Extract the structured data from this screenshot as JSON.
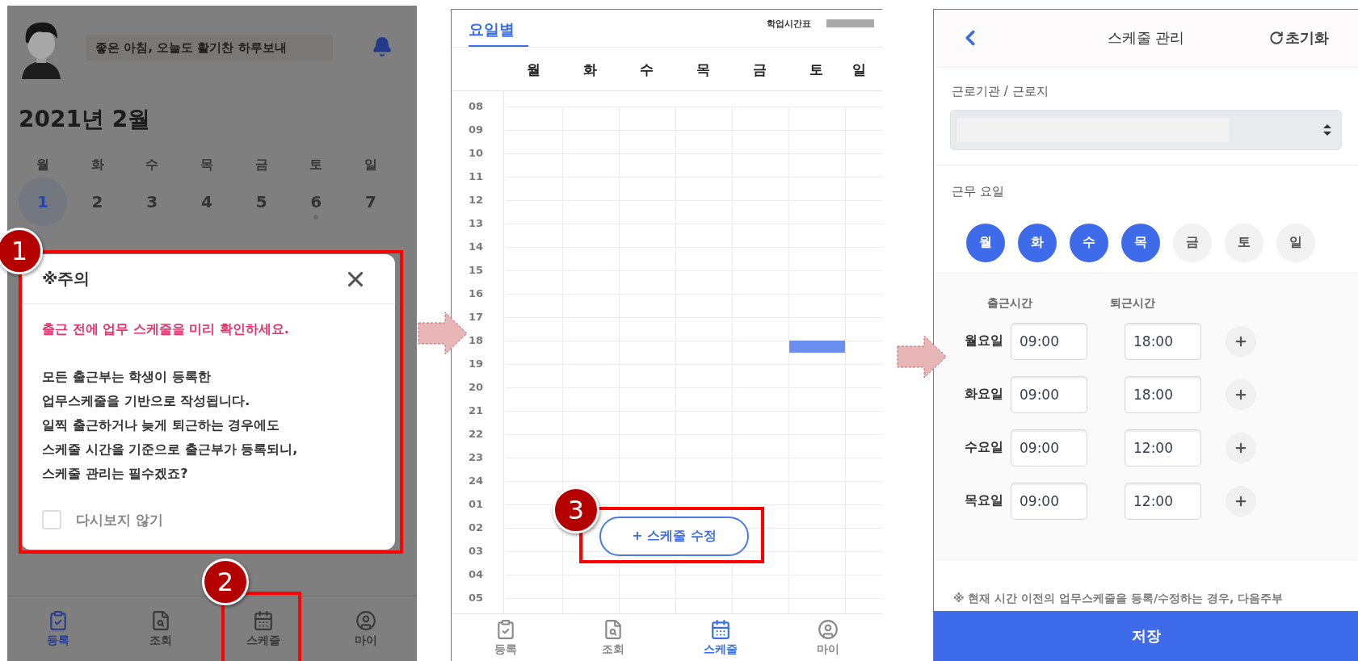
{
  "home_screen": {
    "greeting": "좋은 아침, 오늘도 활기찬 하루보내",
    "month_title": "2021년 2월",
    "weekdays": [
      "월",
      "화",
      "수",
      "목",
      "금",
      "토",
      "일"
    ],
    "dates": [
      {
        "label": "1",
        "selected": true,
        "dot": false
      },
      {
        "label": "2",
        "selected": false,
        "dot": false
      },
      {
        "label": "3",
        "selected": false,
        "dot": false
      },
      {
        "label": "4",
        "selected": false,
        "dot": false
      },
      {
        "label": "5",
        "selected": false,
        "dot": false
      },
      {
        "label": "6",
        "selected": false,
        "dot": true
      },
      {
        "label": "7",
        "selected": false,
        "dot": false
      }
    ],
    "dialog": {
      "title": "※주의",
      "notice": "출근 전에 업무 스케줄을 미리 확인하세요.",
      "message_lines": [
        "모든 출근부는 학생이 등록한",
        "업무스케줄을 기반으로 작성됩니다.",
        "일찍 출근하거나 늦게 퇴근하는 경우에도",
        "스케줄 시간을 기준으로 출근부가 등록되니,",
        "스케줄 관리는 필수겠죠?"
      ],
      "checkbox": {
        "label": "다시보지 않기",
        "checked": false
      }
    },
    "nav": [
      {
        "label": "등록",
        "kind": "register",
        "selected": true
      },
      {
        "label": "조회",
        "kind": "search",
        "selected": false
      },
      {
        "label": "스케줄",
        "kind": "schedule",
        "selected": false
      },
      {
        "label": "마이",
        "kind": "profile",
        "selected": false
      }
    ]
  },
  "timetable_screen": {
    "tab": {
      "label": "요일별",
      "selected": true
    },
    "timetable_label": "학업시간표",
    "days": [
      {
        "label": "월"
      },
      {
        "label": "화"
      },
      {
        "label": "수"
      },
      {
        "label": "목"
      },
      {
        "label": "금"
      },
      {
        "label": "토"
      },
      {
        "label": "일"
      }
    ],
    "hours": [
      {
        "label": "08"
      },
      {
        "label": "09"
      },
      {
        "label": "10"
      },
      {
        "label": "11"
      },
      {
        "label": "12"
      },
      {
        "label": "13"
      },
      {
        "label": "14"
      },
      {
        "label": "15"
      },
      {
        "label": "16"
      },
      {
        "label": "17"
      },
      {
        "label": "18",
        "booked": [
          false,
          false,
          false,
          false,
          false,
          true,
          false
        ]
      },
      {
        "label": "19"
      },
      {
        "label": "20"
      },
      {
        "label": "21"
      },
      {
        "label": "22"
      },
      {
        "label": "23"
      },
      {
        "label": "24"
      },
      {
        "label": "01"
      },
      {
        "label": "02"
      },
      {
        "label": "03"
      },
      {
        "label": "04"
      },
      {
        "label": "05"
      }
    ],
    "edit_button": "+ 스케줄 수정",
    "nav": [
      {
        "label": "등록",
        "kind": "register",
        "selected": false
      },
      {
        "label": "조회",
        "kind": "search",
        "selected": false
      },
      {
        "label": "스케줄",
        "kind": "schedule",
        "selected": true
      },
      {
        "label": "마이",
        "kind": "profile",
        "selected": false
      }
    ]
  },
  "schedule_screen": {
    "title": "스케줄 관리",
    "reset": "초기화",
    "workplace_label": "근로기관 / 근로지",
    "workdays_label": "근무 요일",
    "days": [
      {
        "label": "월",
        "selected": true
      },
      {
        "label": "화",
        "selected": true
      },
      {
        "label": "수",
        "selected": true
      },
      {
        "label": "목",
        "selected": true
      },
      {
        "label": "금",
        "selected": false
      },
      {
        "label": "토",
        "selected": false
      },
      {
        "label": "일",
        "selected": false
      }
    ],
    "time_headers": [
      "출근시간",
      "퇴근시간"
    ],
    "rows": [
      {
        "day": "월요일",
        "start": "09:00",
        "end": "18:00"
      },
      {
        "day": "화요일",
        "start": "09:00",
        "end": "18:00"
      },
      {
        "day": "수요일",
        "start": "09:00",
        "end": "12:00"
      },
      {
        "day": "목요일",
        "start": "09:00",
        "end": "12:00"
      }
    ],
    "note": "※ 현재 시간 이전의 업무스케줄을 등록/수정하는 경우, 다음주부",
    "save": "저장"
  },
  "annotations": [
    {
      "label": "1"
    },
    {
      "label": "2"
    },
    {
      "label": "3"
    }
  ]
}
